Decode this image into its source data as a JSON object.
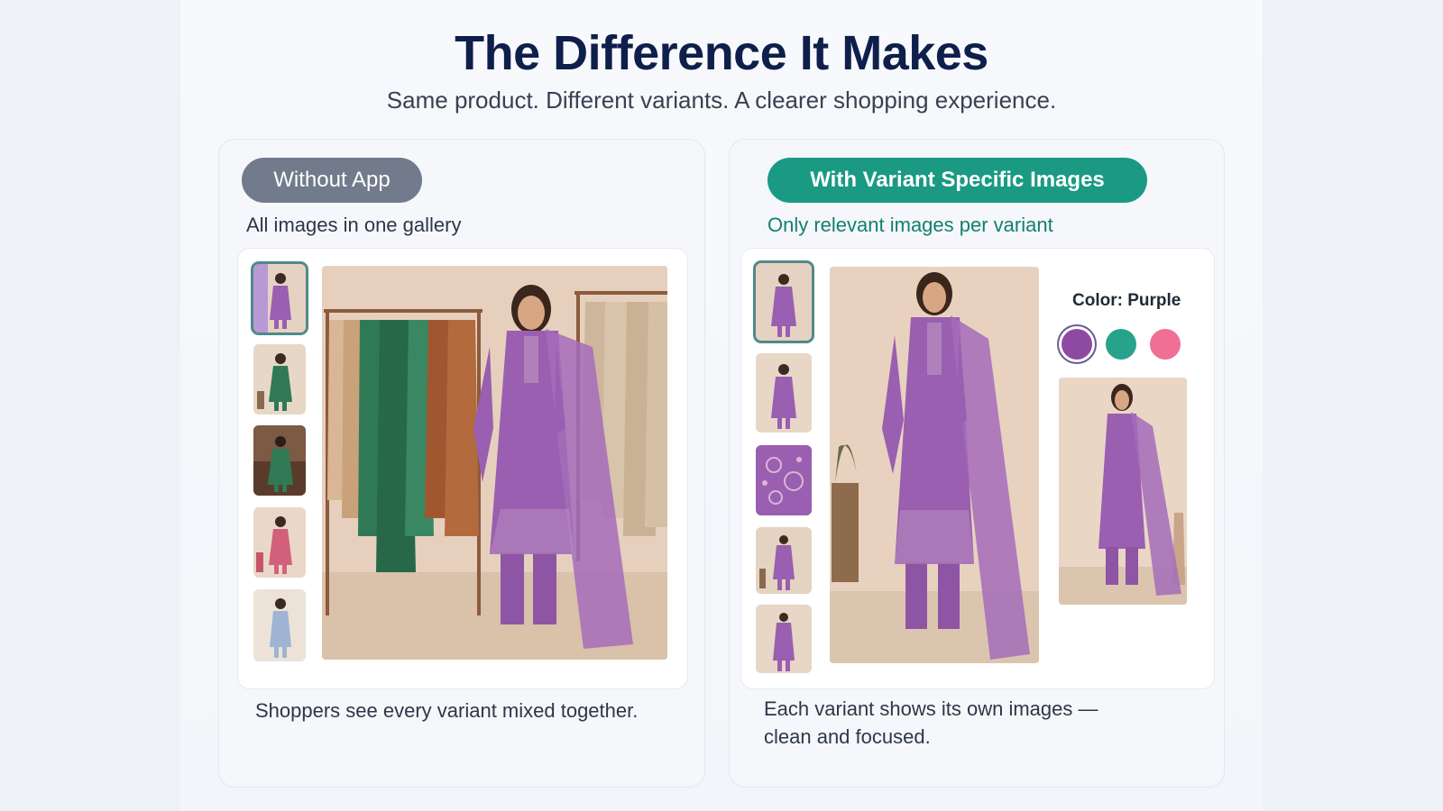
{
  "header": {
    "title": "The Difference It Makes",
    "subtitle": "Same product. Different variants. A clearer shopping experience."
  },
  "left_panel": {
    "badge": "Without App",
    "caption": "All images in one gallery",
    "footer": "Shoppers see every variant mixed together.",
    "thumbnails": [
      {
        "name": "purple-outfit",
        "color": "#9a5fb0"
      },
      {
        "name": "green-outfit",
        "color": "#2f7a55"
      },
      {
        "name": "green-outfit-seated",
        "color": "#2f7a55"
      },
      {
        "name": "pink-outfit",
        "color": "#d2607a"
      },
      {
        "name": "blue-outfit",
        "color": "#9fb3d3"
      }
    ]
  },
  "right_panel": {
    "badge": "With Variant Specific Images",
    "caption": "Only relevant images per variant",
    "footer_line1": "Each variant shows its own images —",
    "footer_line2": "clean and focused.",
    "color_label": "Color: Purple",
    "swatches": [
      {
        "name": "purple",
        "hex": "#8e4aa2",
        "selected": true
      },
      {
        "name": "teal",
        "hex": "#27a38b",
        "selected": false
      },
      {
        "name": "pink",
        "hex": "#ef6f95",
        "selected": false
      }
    ]
  },
  "colors": {
    "title": "#0f1f4b",
    "accent_green": "#1a9a83",
    "badge_gray": "#727b8c",
    "outfit_purple": "#9a5fb0"
  }
}
